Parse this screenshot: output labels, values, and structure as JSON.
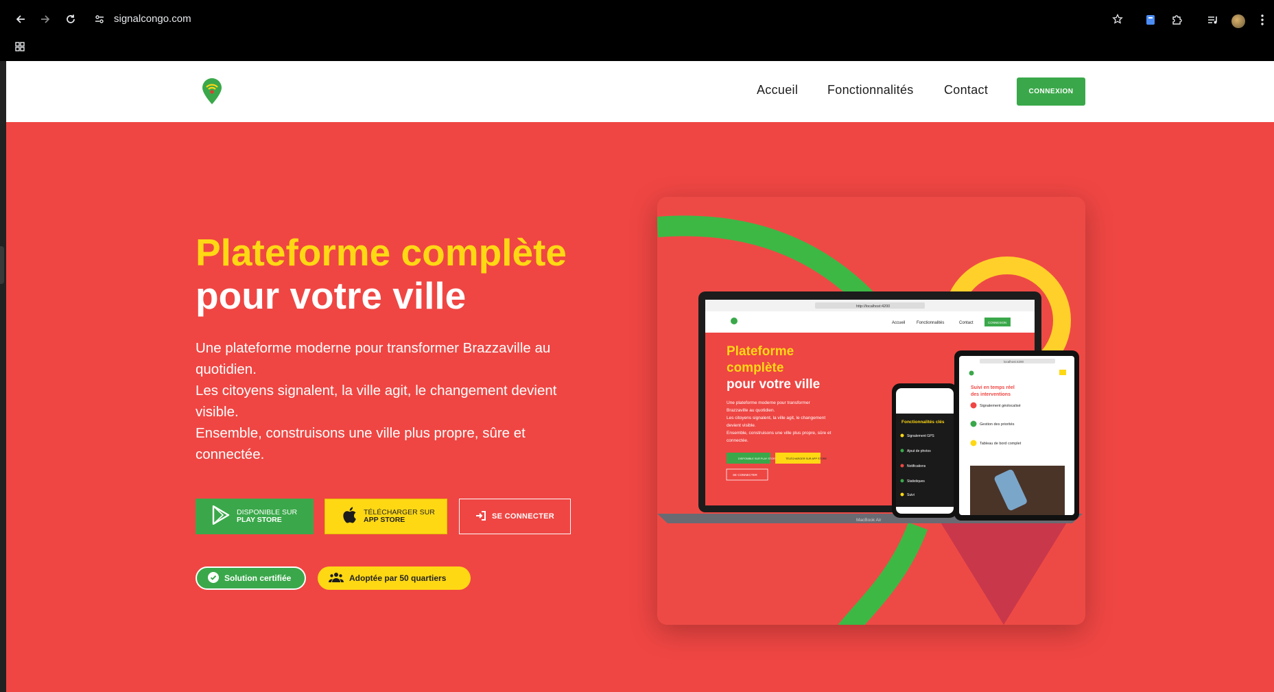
{
  "browser": {
    "url": "signalcongo.com",
    "icons": [
      "back-icon",
      "forward-icon",
      "reload-icon",
      "site-info-icon",
      "bookmark-star-icon",
      "extension-doc-icon",
      "extensions-puzzle-icon",
      "media-playlist-icon",
      "profile-avatar",
      "more-menu-icon",
      "apps-grid-icon"
    ]
  },
  "nav": {
    "links": [
      "Accueil",
      "Fonctionnalités",
      "Contact"
    ],
    "cta": "CONNEXION"
  },
  "hero": {
    "title_line1": "Plateforme complète",
    "title_line2": "pour votre ville",
    "desc": [
      "Une plateforme moderne pour transformer Brazzaville au",
      "quotidien.",
      "Les citoyens signalent, la ville agit, le changement devient",
      "visible.",
      "Ensemble, construisons une ville plus propre, sûre et",
      "connectée."
    ],
    "buttons": {
      "play_small": "DISPONIBLE SUR",
      "play_big": "PLAY STORE",
      "app_small": "TÉLÉCHARGER SUR",
      "app_big": "APP STORE",
      "login": "SE CONNECTER"
    },
    "badges": {
      "certified": "Solution certifiée",
      "quarters": "Adoptée par 50 quartiers"
    }
  },
  "mockup": {
    "laptop_label": "MacBook Air",
    "laptop_url": "http://localhost:4200",
    "laptop_nav": [
      "Accueil",
      "Fonctionnalités",
      "Contact",
      "CONNEXION"
    ],
    "laptop_title": [
      "Plateforme",
      "complète",
      "pour votre ville"
    ],
    "laptop_desc": [
      "Une plateforme moderne pour transformer",
      "Brazzaville au quotidien.",
      "Les citoyens signalent, la ville agit, le changement",
      "devient visible.",
      "Ensemble, construisons une ville plus propre, sûre et",
      "connectée."
    ],
    "laptop_btns": [
      "DISPONIBLE SUR PLAY STORE",
      "TÉLÉCHARGER SUR APP STORE",
      "SE CONNECTER"
    ],
    "phone_title": "Fonctionnalités clés",
    "phone_items": [
      "Signalement GPS",
      "Ajout de photos",
      "Notifications",
      "Statistiques",
      "Suivi"
    ],
    "tablet_url": "localhost:4200",
    "tablet_title": [
      "Suivi en temps réel",
      "des interventions"
    ],
    "tablet_items": [
      "Signalement géolocalisé",
      "Gestion des priorités",
      "Tableau de bord complet"
    ]
  },
  "colors": {
    "brand_red": "#ef4643",
    "brand_green": "#3aa84a",
    "brand_yellow": "#ffd814"
  }
}
